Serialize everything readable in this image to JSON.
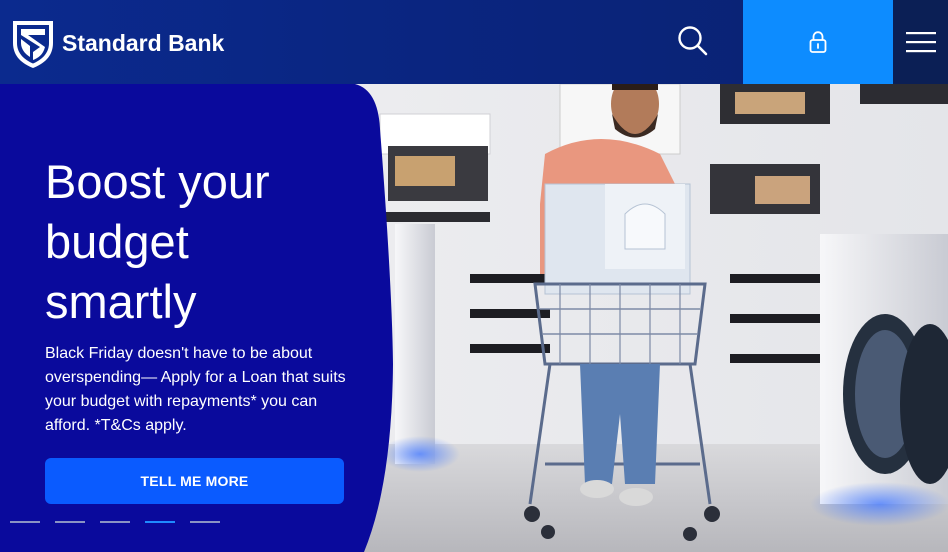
{
  "header": {
    "logo_text": "Standard Bank",
    "search_label": "Search",
    "login_label": "Sign in",
    "menu_label": "Menu"
  },
  "hero": {
    "title_lines": [
      "Boost your",
      "budget",
      "smartly"
    ],
    "body": "Black Friday doesn't have to be about overspending— Apply for a Loan that suits your budget with repayments* you can afford. *T&Cs apply.",
    "cta_label": "TELL ME MORE",
    "slide_count": 5,
    "active_slide": 4
  },
  "icons": {
    "logo": "shield-logo-icon",
    "search": "search-icon",
    "login": "lock-icon",
    "menu": "hamburger-menu-icon"
  },
  "colors": {
    "header_bg": "#0b2a8e",
    "panel_bg": "#0a0a9c",
    "login_bg": "#0d8cff",
    "menu_bg": "#0b1f55",
    "cta_bg": "#0a5bff",
    "active_dot": "#1f8bff"
  }
}
